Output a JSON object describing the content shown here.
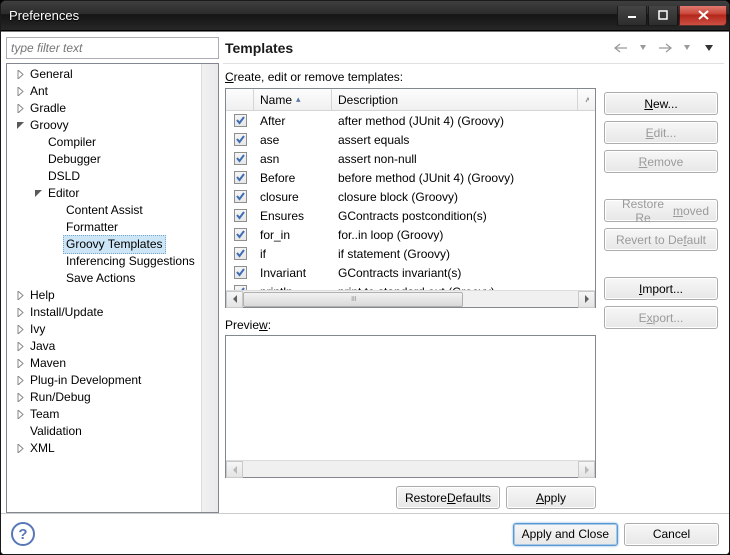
{
  "window": {
    "title": "Preferences"
  },
  "filter": {
    "placeholder": "type filter text"
  },
  "tree": [
    {
      "label": "General",
      "depth": 0,
      "exp": false,
      "hasArrow": true
    },
    {
      "label": "Ant",
      "depth": 0,
      "exp": false,
      "hasArrow": true
    },
    {
      "label": "Gradle",
      "depth": 0,
      "exp": false,
      "hasArrow": true
    },
    {
      "label": "Groovy",
      "depth": 0,
      "exp": true,
      "hasArrow": true
    },
    {
      "label": "Compiler",
      "depth": 1,
      "hasArrow": false
    },
    {
      "label": "Debugger",
      "depth": 1,
      "hasArrow": false
    },
    {
      "label": "DSLD",
      "depth": 1,
      "hasArrow": false
    },
    {
      "label": "Editor",
      "depth": 1,
      "exp": true,
      "hasArrow": true
    },
    {
      "label": "Content Assist",
      "depth": 2,
      "hasArrow": false
    },
    {
      "label": "Formatter",
      "depth": 2,
      "hasArrow": false
    },
    {
      "label": "Groovy Templates",
      "depth": 2,
      "hasArrow": false,
      "selected": true
    },
    {
      "label": "Inferencing Suggestions",
      "depth": 2,
      "hasArrow": false
    },
    {
      "label": "Save Actions",
      "depth": 2,
      "hasArrow": false
    },
    {
      "label": "Help",
      "depth": 0,
      "exp": false,
      "hasArrow": true
    },
    {
      "label": "Install/Update",
      "depth": 0,
      "exp": false,
      "hasArrow": true
    },
    {
      "label": "Ivy",
      "depth": 0,
      "exp": false,
      "hasArrow": true
    },
    {
      "label": "Java",
      "depth": 0,
      "exp": false,
      "hasArrow": true
    },
    {
      "label": "Maven",
      "depth": 0,
      "exp": false,
      "hasArrow": true
    },
    {
      "label": "Plug-in Development",
      "depth": 0,
      "exp": false,
      "hasArrow": true
    },
    {
      "label": "Run/Debug",
      "depth": 0,
      "exp": false,
      "hasArrow": true
    },
    {
      "label": "Team",
      "depth": 0,
      "exp": false,
      "hasArrow": true
    },
    {
      "label": "Validation",
      "depth": 0,
      "hasArrow": false
    },
    {
      "label": "XML",
      "depth": 0,
      "exp": false,
      "hasArrow": true
    }
  ],
  "page": {
    "title": "Templates",
    "caption_pre": "C",
    "caption_rest": "reate, edit or remove templates:",
    "col_name": "Name",
    "col_desc": "Description",
    "preview_pre": "Previe",
    "preview_ul": "w",
    "preview_post": ":",
    "restore_defaults_pre": "Restore ",
    "restore_defaults_ul": "D",
    "restore_defaults_post": "efaults",
    "apply_ul": "A",
    "apply_post": "pply"
  },
  "templates": [
    {
      "checked": true,
      "name": "After",
      "desc": "after method (JUnit 4) (Groovy)"
    },
    {
      "checked": true,
      "name": "ase",
      "desc": "assert equals"
    },
    {
      "checked": true,
      "name": "asn",
      "desc": "assert non-null"
    },
    {
      "checked": true,
      "name": "Before",
      "desc": "before method (JUnit 4) (Groovy)"
    },
    {
      "checked": true,
      "name": "closure",
      "desc": "closure block (Groovy)"
    },
    {
      "checked": true,
      "name": "Ensures",
      "desc": "GContracts postcondition(s)"
    },
    {
      "checked": true,
      "name": "for_in",
      "desc": "for..in loop (Groovy)"
    },
    {
      "checked": true,
      "name": "if",
      "desc": "if statement (Groovy)"
    },
    {
      "checked": true,
      "name": "Invariant",
      "desc": "GContracts invariant(s)"
    },
    {
      "checked": true,
      "name": "println",
      "desc": "print to standard out (Groovy)"
    }
  ],
  "side_buttons": {
    "new_ul": "N",
    "new_post": "ew...",
    "edit_ul": "E",
    "edit_post": "dit...",
    "remove_ul": "R",
    "remove_post": "emove",
    "restore_removed": "Restore Re",
    "restore_removed_ul": "m",
    "restore_removed_post": "oved",
    "revert": "Revert to De",
    "revert_ul": "f",
    "revert_post": "ault",
    "import_ul": "I",
    "import_post": "mport...",
    "export_pre": "E",
    "export_ul": "x",
    "export_post": "port..."
  },
  "footer": {
    "apply_close": "Apply and Close",
    "cancel": "Cancel"
  }
}
